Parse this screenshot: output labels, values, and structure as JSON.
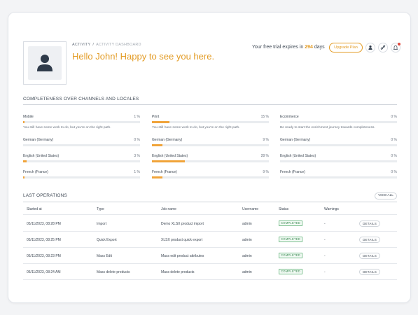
{
  "breadcrumb": {
    "parent": "ACTIVITY",
    "separator": "/",
    "current": "ACTIVITY DASHBOARD"
  },
  "greeting": "Hello John! Happy to see you here.",
  "trial": {
    "prefix": "Your free trial expires in",
    "days": "294",
    "suffix": "days"
  },
  "header": {
    "upgrade_label": "Upgrade Plan"
  },
  "icons": {
    "user": "user-icon",
    "link": "link-icon",
    "bell": "bell-icon",
    "avatar": "avatar-placeholder-icon"
  },
  "colors": {
    "accent": "#e39c26",
    "progress": "#f0a43a",
    "status_green": "#3d8b54",
    "notification": "#e0483c"
  },
  "completeness": {
    "title": "COMPLETENESS OVER CHANNELS AND LOCALES",
    "channels": [
      {
        "name": "Mobile",
        "percent": 1,
        "percent_label": "1 %",
        "message": "You still have some work to do, but you're on the right path.",
        "locales": [
          {
            "name": "German (Germany)",
            "percent": 0,
            "percent_label": "0 %"
          },
          {
            "name": "English (United States)",
            "percent": 3,
            "percent_label": "3 %"
          },
          {
            "name": "French (France)",
            "percent": 1,
            "percent_label": "1 %"
          }
        ]
      },
      {
        "name": "Print",
        "percent": 15,
        "percent_label": "15 %",
        "message": "You still have some work to do, but you're on the right path.",
        "locales": [
          {
            "name": "German (Germany)",
            "percent": 9,
            "percent_label": "9 %"
          },
          {
            "name": "English (United States)",
            "percent": 28,
            "percent_label": "28 %"
          },
          {
            "name": "French (France)",
            "percent": 9,
            "percent_label": "9 %"
          }
        ]
      },
      {
        "name": "Ecommerce",
        "percent": 0,
        "percent_label": "0 %",
        "message": "Be ready to start the enrichment journey towards completeness.",
        "locales": [
          {
            "name": "German (Germany)",
            "percent": 0,
            "percent_label": "0 %"
          },
          {
            "name": "English (United States)",
            "percent": 0,
            "percent_label": "0 %"
          },
          {
            "name": "French (France)",
            "percent": 0,
            "percent_label": "0 %"
          }
        ]
      }
    ]
  },
  "operations": {
    "title": "LAST OPERATIONS",
    "view_all_label": "VIEW ALL",
    "columns": [
      "Started at",
      "Type",
      "Job name",
      "Username",
      "Status",
      "Warnings"
    ],
    "rows": [
      {
        "started": "05/11/2023, 08:28 PM",
        "type": "Import",
        "job": "Demo XLSX product import",
        "user": "admin",
        "status": "COMPLETED",
        "warnings": "-",
        "action": "DETAILS"
      },
      {
        "started": "05/11/2023, 08:25 PM",
        "type": "Quick Export",
        "job": "XLSX product quick export",
        "user": "admin",
        "status": "COMPLETED",
        "warnings": "-",
        "action": "DETAILS"
      },
      {
        "started": "05/11/2023, 08:23 PM",
        "type": "Mass Edit",
        "job": "Mass edit product attributes",
        "user": "admin",
        "status": "COMPLETED",
        "warnings": "-",
        "action": "DETAILS"
      },
      {
        "started": "05/11/2023, 08:24 AM",
        "type": "Mass delete products",
        "job": "Mass delete products",
        "user": "admin",
        "status": "COMPLETED",
        "warnings": "-",
        "action": "DETAILS"
      }
    ]
  }
}
